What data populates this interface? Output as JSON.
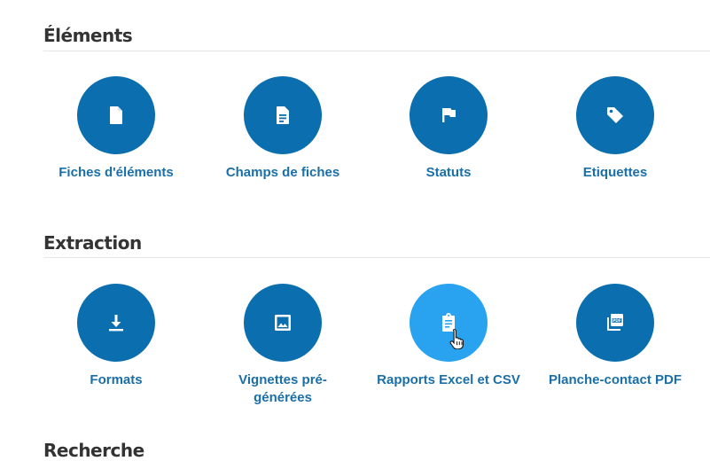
{
  "sections": [
    {
      "title": "Éléments",
      "tiles": [
        {
          "label": "Fiches d'éléments",
          "icon": "file-icon"
        },
        {
          "label": "Champs de fiches",
          "icon": "document-lines-icon"
        },
        {
          "label": "Statuts",
          "icon": "flag-icon"
        },
        {
          "label": "Etiquettes",
          "icon": "tag-icon"
        }
      ]
    },
    {
      "title": "Extraction",
      "tiles": [
        {
          "label": "Formats",
          "icon": "download-icon"
        },
        {
          "label": "Vignettes pré-générées",
          "icon": "image-icon"
        },
        {
          "label": "Rapports Excel et CSV",
          "icon": "clipboard-report-icon",
          "hovered": true
        },
        {
          "label": "Planche-contact PDF",
          "icon": "pdf-pages-icon"
        }
      ]
    },
    {
      "title": "Recherche",
      "tiles": []
    }
  ],
  "colors": {
    "circle": "#0a6eaf",
    "circle_hover": "#29a3f0",
    "label": "#1b6fa8",
    "heading": "#333333"
  }
}
